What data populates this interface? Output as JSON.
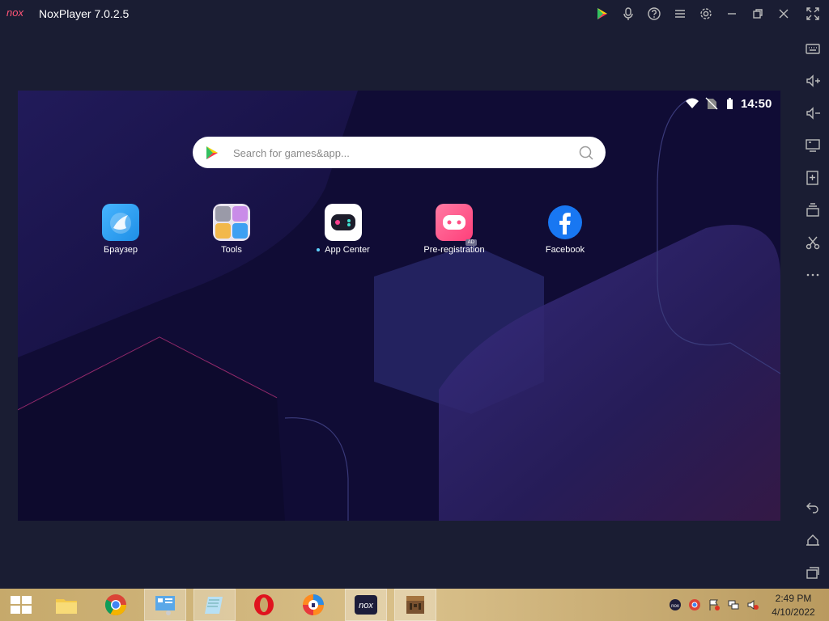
{
  "window": {
    "title": "NoxPlayer 7.0.2.5"
  },
  "status_bar": {
    "time": "14:50"
  },
  "search": {
    "placeholder": "Search for games&app..."
  },
  "apps": [
    {
      "label": "Браузер",
      "icon": "browser-icon"
    },
    {
      "label": "Tools",
      "icon": "tools-folder-icon"
    },
    {
      "label": "App Center",
      "icon": "app-center-icon",
      "new_dot": true
    },
    {
      "label": "Pre-registration",
      "icon": "pre-registration-icon",
      "badge": "AD"
    },
    {
      "label": "Facebook",
      "icon": "facebook-icon"
    }
  ],
  "taskbar": {
    "time": "2:49 PM",
    "date": "4/10/2022"
  },
  "colors": {
    "window_bg": "#1a1d33",
    "screen_bg": "#100c35",
    "taskbar": "#c6a96b",
    "facebook_blue": "#1877f2",
    "pink_accent": "#ff4f86"
  }
}
